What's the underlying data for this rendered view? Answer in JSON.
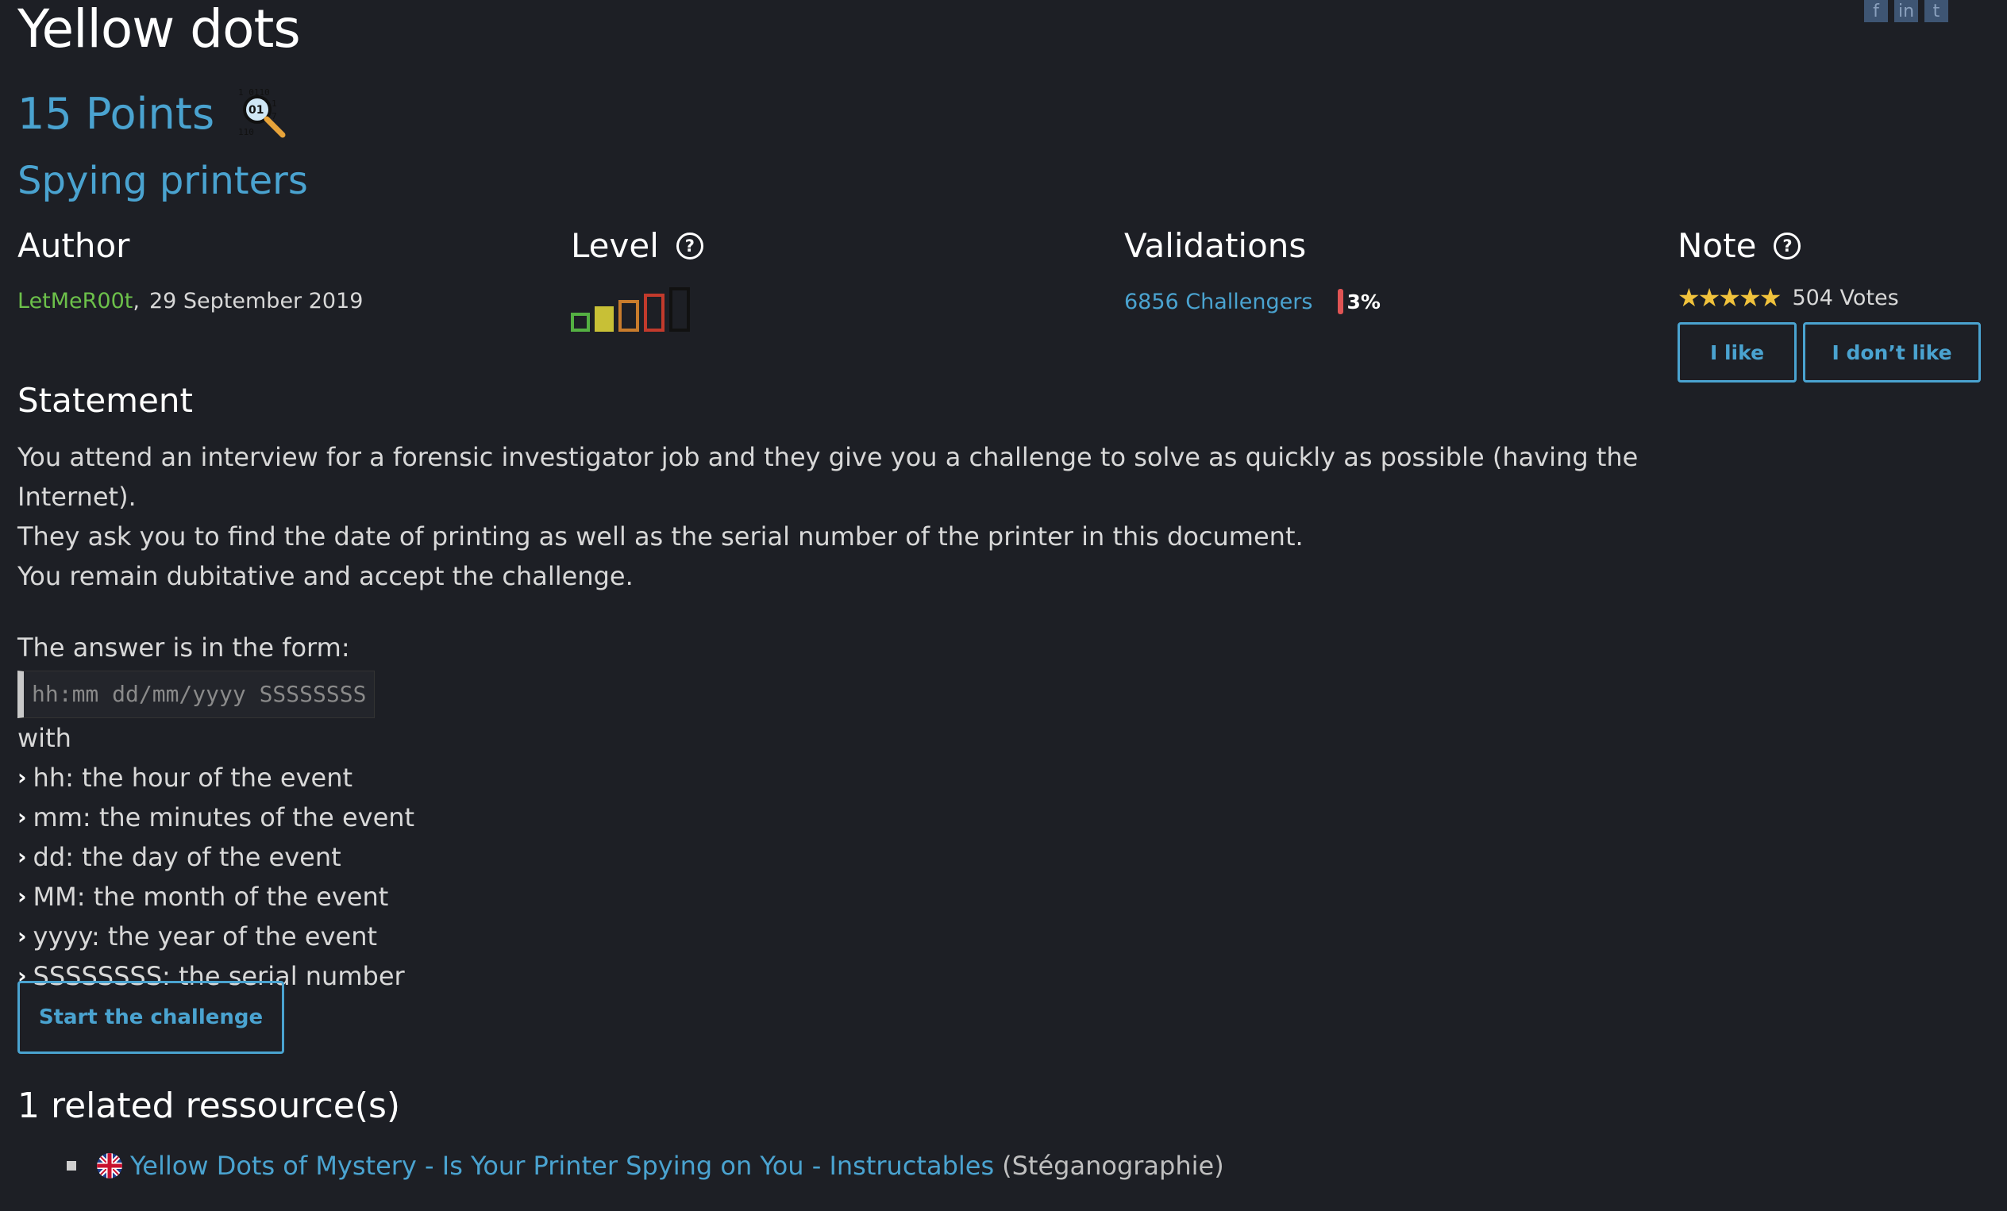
{
  "header": {
    "title": "Yellow dots",
    "points": "15 Points",
    "subcategory": "Spying printers",
    "category_icon": "magnifier-binary-icon",
    "social": [
      "f",
      "in",
      "t"
    ]
  },
  "author": {
    "heading": "Author",
    "name": "LetMeR00t",
    "separator": ",",
    "date": "29 September 2019"
  },
  "level": {
    "heading": "Level",
    "help": "?",
    "value": 2,
    "max": 5,
    "colors": [
      "#54b042",
      "#c8c036",
      "#c97c2c",
      "#c23a2c",
      "#111111"
    ]
  },
  "validations": {
    "heading": "Validations",
    "challengers": "6856 Challengers",
    "percent": "3%"
  },
  "note": {
    "heading": "Note",
    "help": "?",
    "stars": "★★★★★",
    "votes": "504 Votes",
    "like_label": "I like",
    "dislike_label": "I don’t like"
  },
  "statement": {
    "heading": "Statement",
    "lines": [
      "You attend an interview for a forensic investigator job and they give you a challenge to solve as quickly as possible (having the Internet).",
      "They ask you to find the date of printing as well as the serial number of the printer in this document.",
      "You remain dubitative and accept the challenge."
    ],
    "form_intro": "The answer is in the form:",
    "format": "hh:mm dd/mm/yyyy SSSSSSSS",
    "with": "with",
    "bullets": [
      "hh: the hour of the event",
      "mm: the minutes of the event",
      "dd: the day of the event",
      "MM: the month of the event",
      "yyyy: the year of the event",
      "SSSSSSSS: the serial number"
    ]
  },
  "start_label": "Start the challenge",
  "related": {
    "heading": "1 related ressource(s)",
    "items": [
      {
        "flag": "uk-flag-icon",
        "title": "Yellow Dots of Mystery - Is Your Printer Spying on You - Instructables",
        "category": "(Stéganographie)"
      }
    ]
  }
}
